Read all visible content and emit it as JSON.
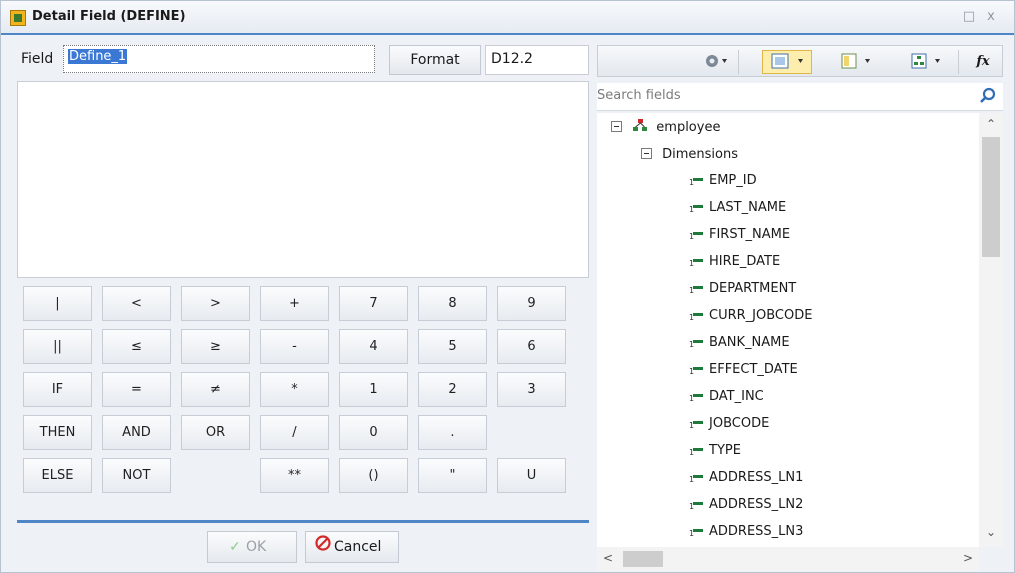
{
  "window": {
    "title": "Detail Field (DEFINE)",
    "minimize_glyph": "□",
    "close_glyph": "x"
  },
  "field": {
    "label": "Field",
    "value": "Define_1"
  },
  "format": {
    "button_label": "Format",
    "value": "D12.2"
  },
  "keypad": {
    "rows": [
      [
        "|",
        "<",
        ">",
        "+",
        "7",
        "8",
        "9"
      ],
      [
        "||",
        "≤",
        "≥",
        "-",
        "4",
        "5",
        "6"
      ],
      [
        "IF",
        "=",
        "≠",
        "*",
        "1",
        "2",
        "3"
      ],
      [
        "THEN",
        "AND",
        "OR",
        "/",
        "0",
        ".",
        ""
      ],
      [
        "ELSE",
        "NOT",
        "",
        "**",
        "()",
        "\"",
        "U"
      ]
    ]
  },
  "actions": {
    "ok_label": "OK",
    "cancel_label": "Cancel"
  },
  "toolbar": {
    "icons": [
      "gear-icon",
      "select-field-icon",
      "layout-icon",
      "hierarchy-icon",
      "function-icon"
    ],
    "fx_label": "fx"
  },
  "search": {
    "placeholder": "Search fields"
  },
  "tree": {
    "root": "employee",
    "group": "Dimensions",
    "fields": [
      "EMP_ID",
      "LAST_NAME",
      "FIRST_NAME",
      "HIRE_DATE",
      "DEPARTMENT",
      "CURR_JOBCODE",
      "BANK_NAME",
      "EFFECT_DATE",
      "DAT_INC",
      "JOBCODE",
      "TYPE",
      "ADDRESS_LN1",
      "ADDRESS_LN2",
      "ADDRESS_LN3"
    ]
  }
}
